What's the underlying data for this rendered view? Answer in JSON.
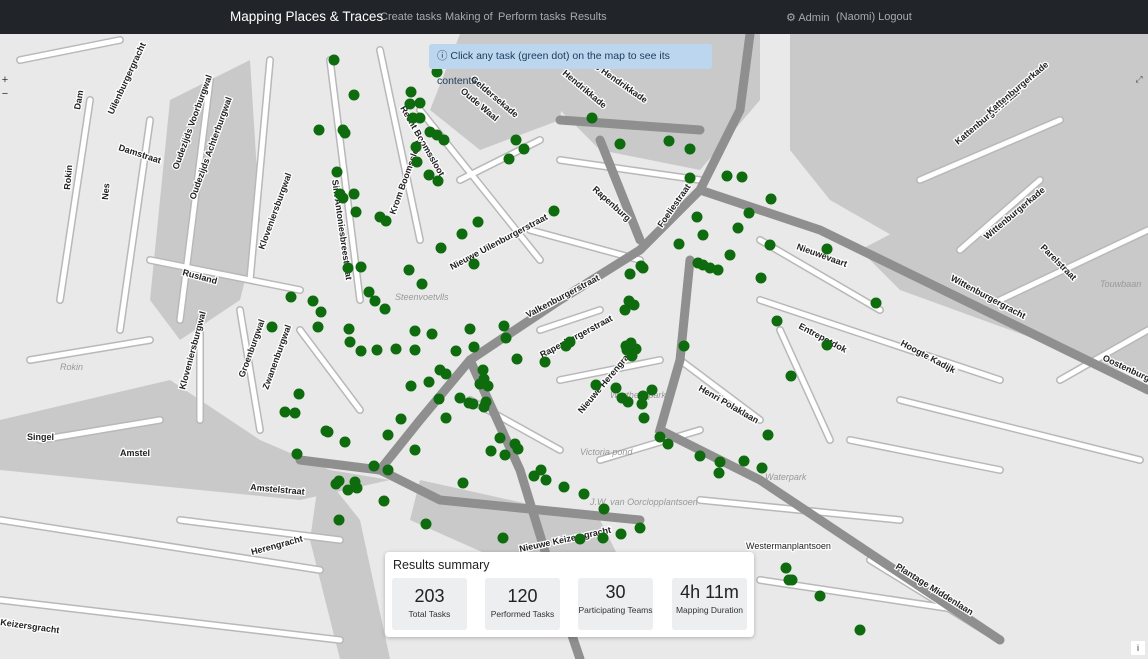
{
  "navbar": {
    "brand": "Mapping Places & Traces",
    "links": [
      "Create tasks",
      "Making of",
      "Perform tasks",
      "Results"
    ],
    "admin_label": "Admin",
    "logout_label": "(Naomi) Logout"
  },
  "map": {
    "info_banner": "Click any task (green dot) on the map to see its contents.",
    "zoom_in": "+",
    "zoom_out": "−",
    "attribution": "i",
    "task_dot_color": "#0e6b0e",
    "street_labels": [
      "Dam",
      "Rokin",
      "Nes",
      "Damstraat",
      "Oudezijds Voorburgwal",
      "Oudezijds Achterburgwal",
      "Kloveniersburgwal",
      "Rusland",
      "Sint Antoniesbreestraat",
      "Recht Boomssloot",
      "Krom Boomssloot",
      "Oude Waal",
      "Hendrikkade",
      "Geldersekade",
      "Rapenburg",
      "Foeliestraat",
      "Nieuwe Uilenburgerstraat",
      "Valkenburgerstraat",
      "Rapenburgerstraat",
      "Nieuwe Herengracht",
      "Henri Polaklaan",
      "Nieuwevaart",
      "Entrepotdok",
      "Hoogte Kadijk",
      "Wittenburgergracht",
      "Kattenburgerstraat",
      "Wittenburgerkade",
      "Oostenburg",
      "Groenburgwal",
      "Zwanenburgwal",
      "Kloveniersburgwal",
      "Singel",
      "Amstel",
      "Amstelstraat",
      "Herengracht",
      "Keizersgracht",
      "Nieuwe Keizersgracht",
      "Plantage Middenlaan",
      "Westermanplantsoen",
      "Touwbaan",
      "Parelstraat",
      "Uilenburgergracht",
      "Prins Hendrikkade",
      "Kattenburgerkade"
    ],
    "area_labels": [
      "Steenvoetvlls",
      "Wertheimpark",
      "Victoria pond",
      "J.W. van Oorclopplantsoen",
      "Waterpark",
      "Rokin"
    ]
  },
  "summary": {
    "title": "Results summary",
    "cards": [
      {
        "value": "203",
        "label": "Total Tasks"
      },
      {
        "value": "120",
        "label": "Performed Tasks"
      },
      {
        "value": "30",
        "label": "Participating Teams"
      },
      {
        "value": "4h 11m",
        "label": "Mapping Duration"
      }
    ]
  }
}
